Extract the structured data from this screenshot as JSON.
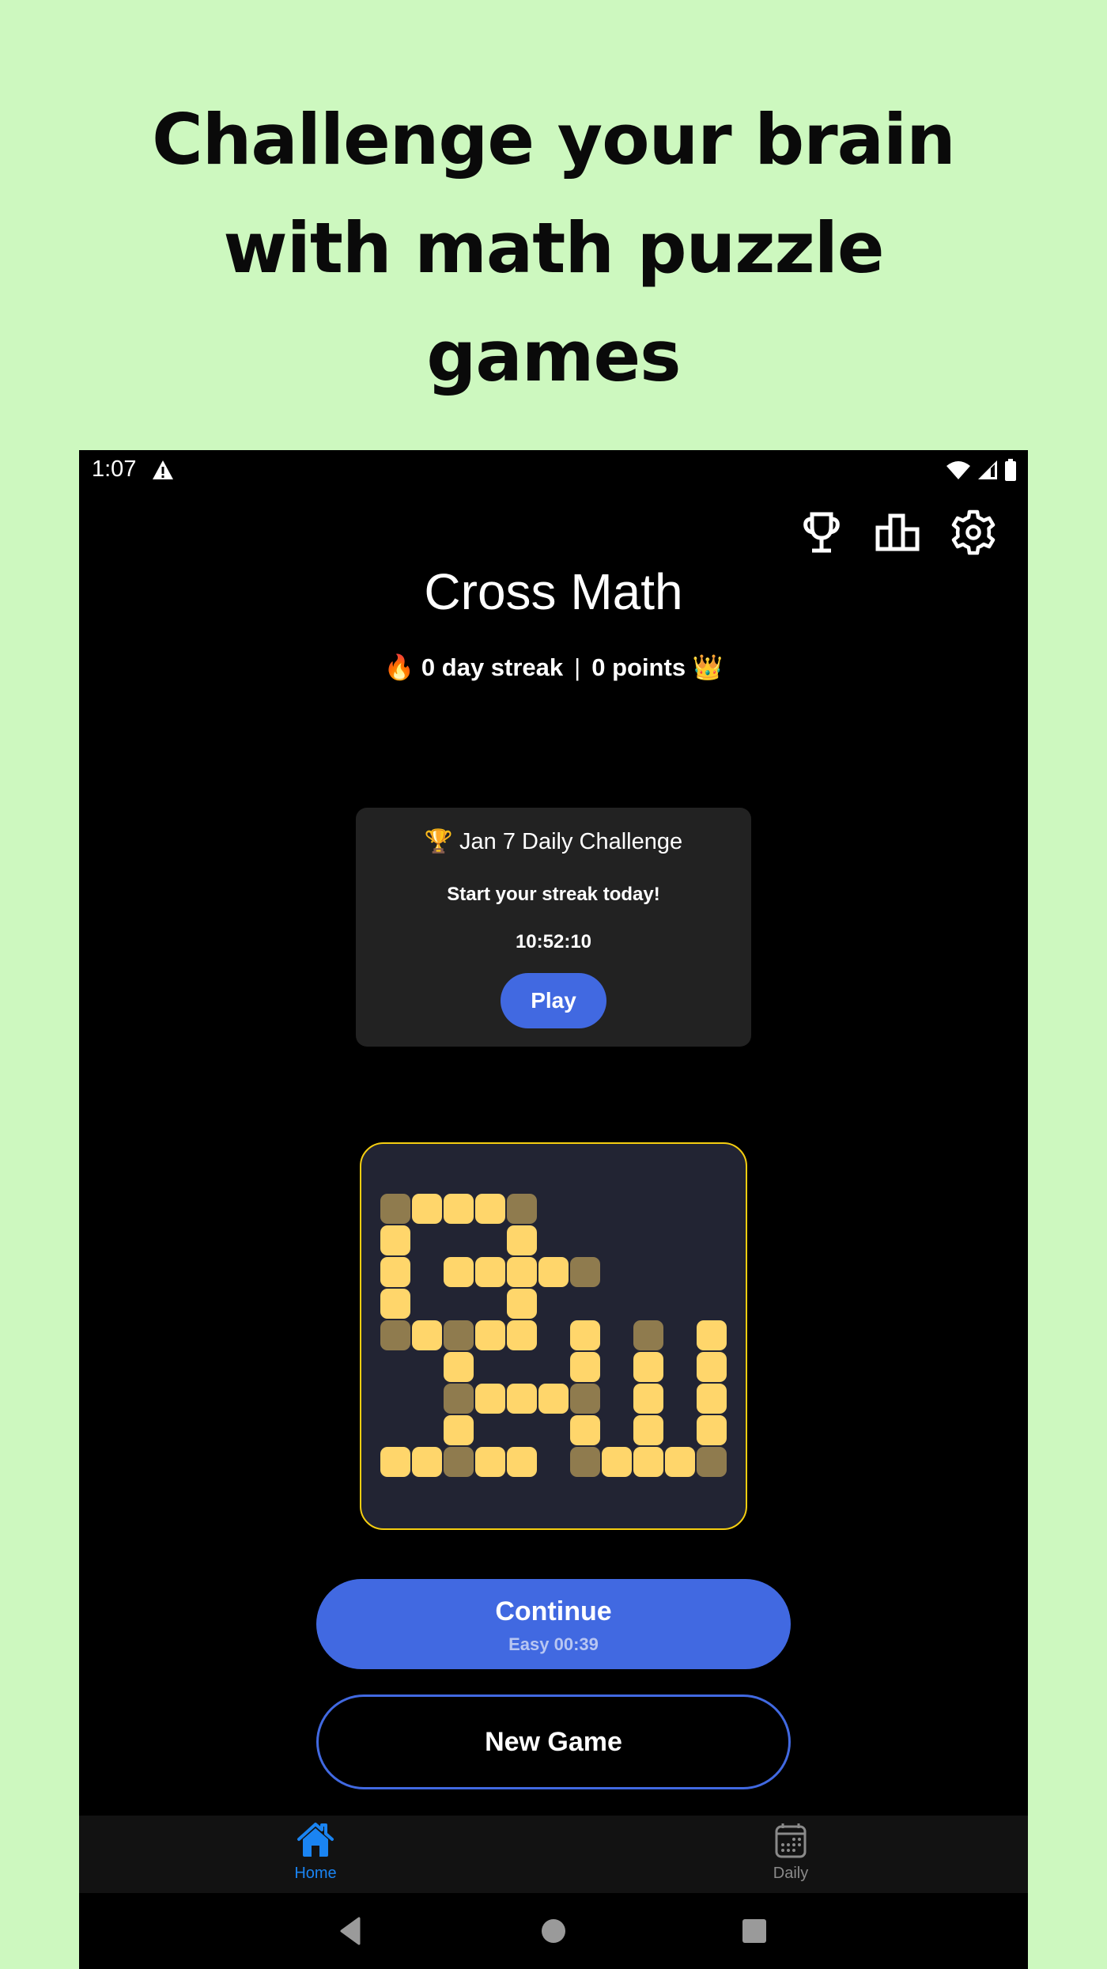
{
  "promo": {
    "headline_lines": [
      "Challenge your brain",
      "with math puzzle",
      "games"
    ]
  },
  "status_bar": {
    "time": "1:07",
    "left_icons": [
      "warning-icon"
    ],
    "right_icons": [
      "wifi-icon",
      "cell-signal-icon",
      "battery-icon"
    ]
  },
  "top_actions": [
    {
      "name": "achievements",
      "icon": "trophy-icon"
    },
    {
      "name": "leaderboard",
      "icon": "leaderboard-icon"
    },
    {
      "name": "settings",
      "icon": "gear-icon"
    }
  ],
  "app": {
    "title": "Cross Math",
    "streak": {
      "fire_emoji": "🔥",
      "streak_text": "0 day streak",
      "separator": "|",
      "points_text": "0 points",
      "crown_emoji": "👑"
    }
  },
  "daily_challenge": {
    "trophy_emoji": "🏆",
    "title": "Jan 7 Daily Challenge",
    "subtitle": "Start your streak today!",
    "timer": "10:52:10",
    "play_label": "Play"
  },
  "board_preview": {
    "colors": {
      "light": "#FFD66B",
      "dark": "#8F7B4E",
      "background": "#222433",
      "border": "#F5CE10"
    },
    "rows": [
      "DLLLD......",
      "L...L......",
      "L.LLLLD....",
      "L...L......",
      "DLDLL.L.D.L",
      "..L...L.L.L",
      "..DLLLD.L.L",
      "..L...L.L.L",
      "LLDLL.DLLLD"
    ]
  },
  "actions": {
    "continue_label": "Continue",
    "continue_sub": "Easy 00:39",
    "new_game_label": "New Game"
  },
  "tabs": [
    {
      "label": "Home",
      "icon": "home-icon",
      "active": true
    },
    {
      "label": "Daily",
      "icon": "calendar-icon",
      "active": false
    }
  ],
  "nav_bar": [
    "back",
    "home",
    "recents"
  ],
  "colors": {
    "accent": "#4169E1",
    "tab_active": "#1A84F2",
    "tab_inactive": "#8a8a8a",
    "page_bg": "#CDF8BF"
  }
}
